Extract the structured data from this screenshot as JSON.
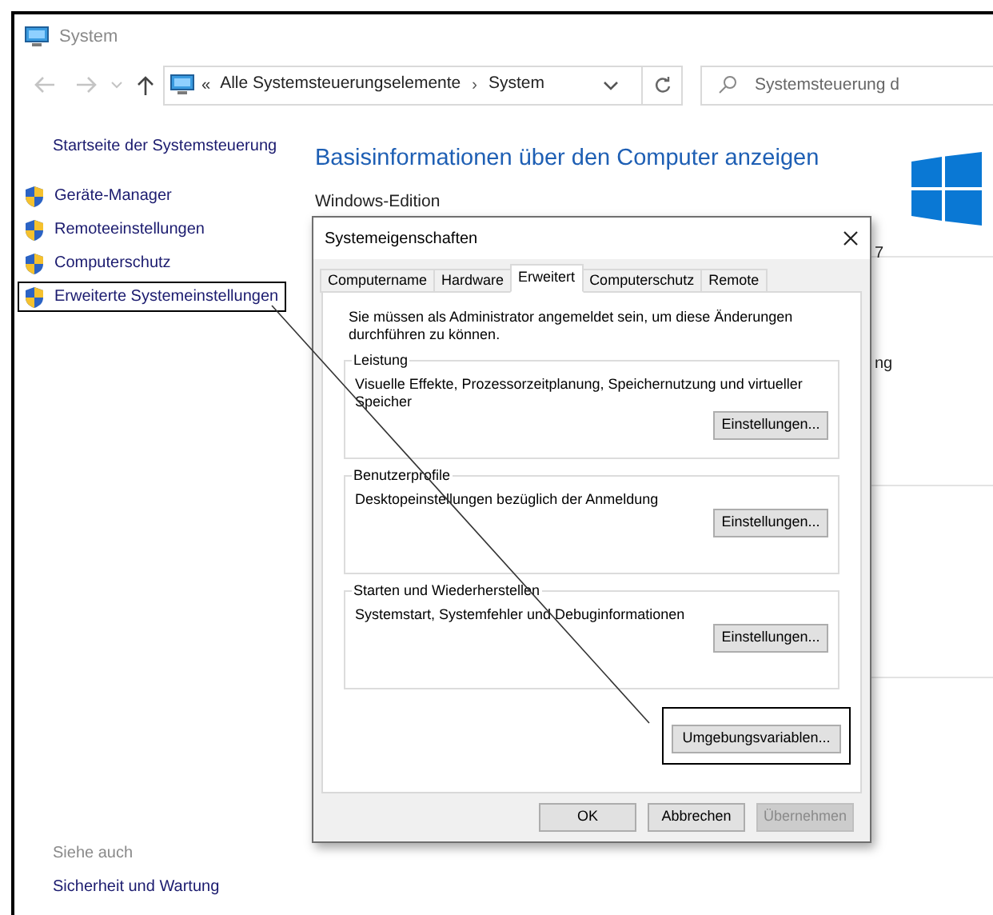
{
  "window": {
    "title": "System"
  },
  "navigation": {
    "prefix": "«",
    "breadcrumb": [
      "Alle Systemsteuerungselemente",
      "System"
    ],
    "separator": "›",
    "search": {
      "placeholder": "Systemsteuerung d"
    }
  },
  "sidebar": {
    "home_link": "Startseite der Systemsteuerung",
    "items": [
      {
        "label": "Geräte-Manager",
        "highlighted": false
      },
      {
        "label": "Remoteeinstellungen",
        "highlighted": false
      },
      {
        "label": "Computerschutz",
        "highlighted": false
      },
      {
        "label": "Erweiterte Systemeinstellungen",
        "highlighted": true
      }
    ],
    "see_also": {
      "heading": "Siehe auch",
      "links": [
        "Sicherheit und Wartung"
      ]
    }
  },
  "main": {
    "heading": "Basisinformationen über den Computer anzeigen",
    "section": "Windows-Edition",
    "fragments": [
      "7",
      "ng"
    ]
  },
  "dialog": {
    "title": "Systemeigenschaften",
    "tabs": [
      {
        "label": "Computername",
        "selected": false
      },
      {
        "label": "Hardware",
        "selected": false
      },
      {
        "label": "Erweitert",
        "selected": true
      },
      {
        "label": "Computerschutz",
        "selected": false
      },
      {
        "label": "Remote",
        "selected": false
      }
    ],
    "notice": "Sie müssen als Administrator angemeldet sein, um diese Änderungen durchführen zu können.",
    "groups": [
      {
        "legend": "Leistung",
        "description": "Visuelle Effekte, Prozessorzeitplanung, Speichernutzung und virtueller Speicher",
        "button": "Einstellungen..."
      },
      {
        "legend": "Benutzerprofile",
        "description": "Desktopeinstellungen bezüglich der Anmeldung",
        "button": "Einstellungen..."
      },
      {
        "legend": "Starten und Wiederherstellen",
        "description": "Systemstart, Systemfehler und Debuginformationen",
        "button": "Einstellungen..."
      }
    ],
    "env_button": {
      "label": "Umgebungsvariablen...",
      "highlighted": true
    },
    "buttons": [
      {
        "label": "OK",
        "disabled": false
      },
      {
        "label": "Abbrechen",
        "disabled": false
      },
      {
        "label": "Übernehmen",
        "disabled": true
      }
    ]
  }
}
